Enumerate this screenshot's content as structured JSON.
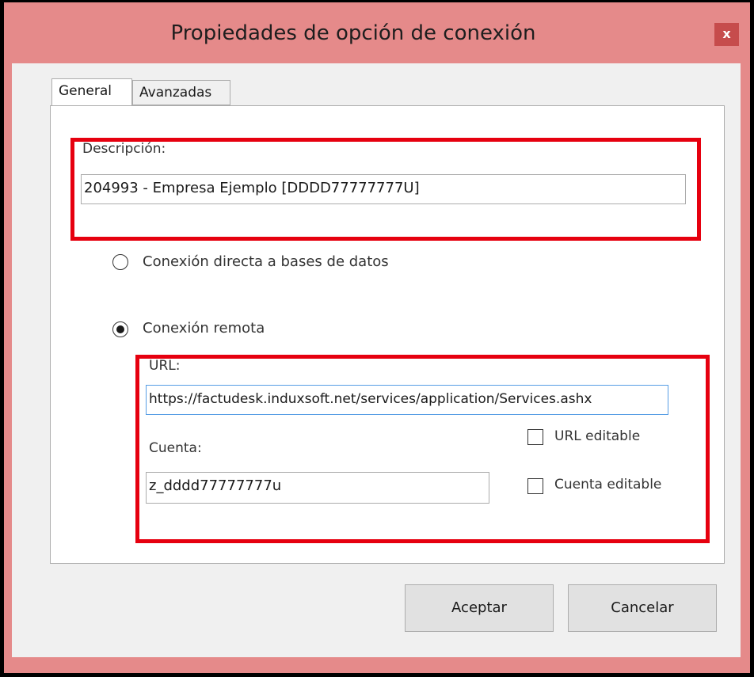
{
  "window": {
    "title": "Propiedades de opción de conexión",
    "close_label": "x"
  },
  "tabs": {
    "general": "General",
    "avanzadas": "Avanzadas"
  },
  "descripcion": {
    "label": "Descripción:",
    "value": "204993 - Empresa Ejemplo [DDDD77777777U]"
  },
  "connection": {
    "direct_label": "Conexión directa a bases de datos",
    "direct_selected": false,
    "remote_label": "Conexión remota",
    "remote_selected": true
  },
  "remote": {
    "url_label": "URL:",
    "url_value": "https://factudesk.induxsoft.net/services/application/Services.ashx",
    "cuenta_label": "Cuenta:",
    "cuenta_value": "z_dddd77777777u",
    "url_editable_label": "URL editable",
    "url_editable_checked": false,
    "cuenta_editable_label": "Cuenta editable",
    "cuenta_editable_checked": false
  },
  "buttons": {
    "accept": "Aceptar",
    "cancel": "Cancelar"
  },
  "colors": {
    "title_bar": "#e58a8a",
    "close_button": "#c64c4c",
    "highlight": "#e6000f"
  }
}
